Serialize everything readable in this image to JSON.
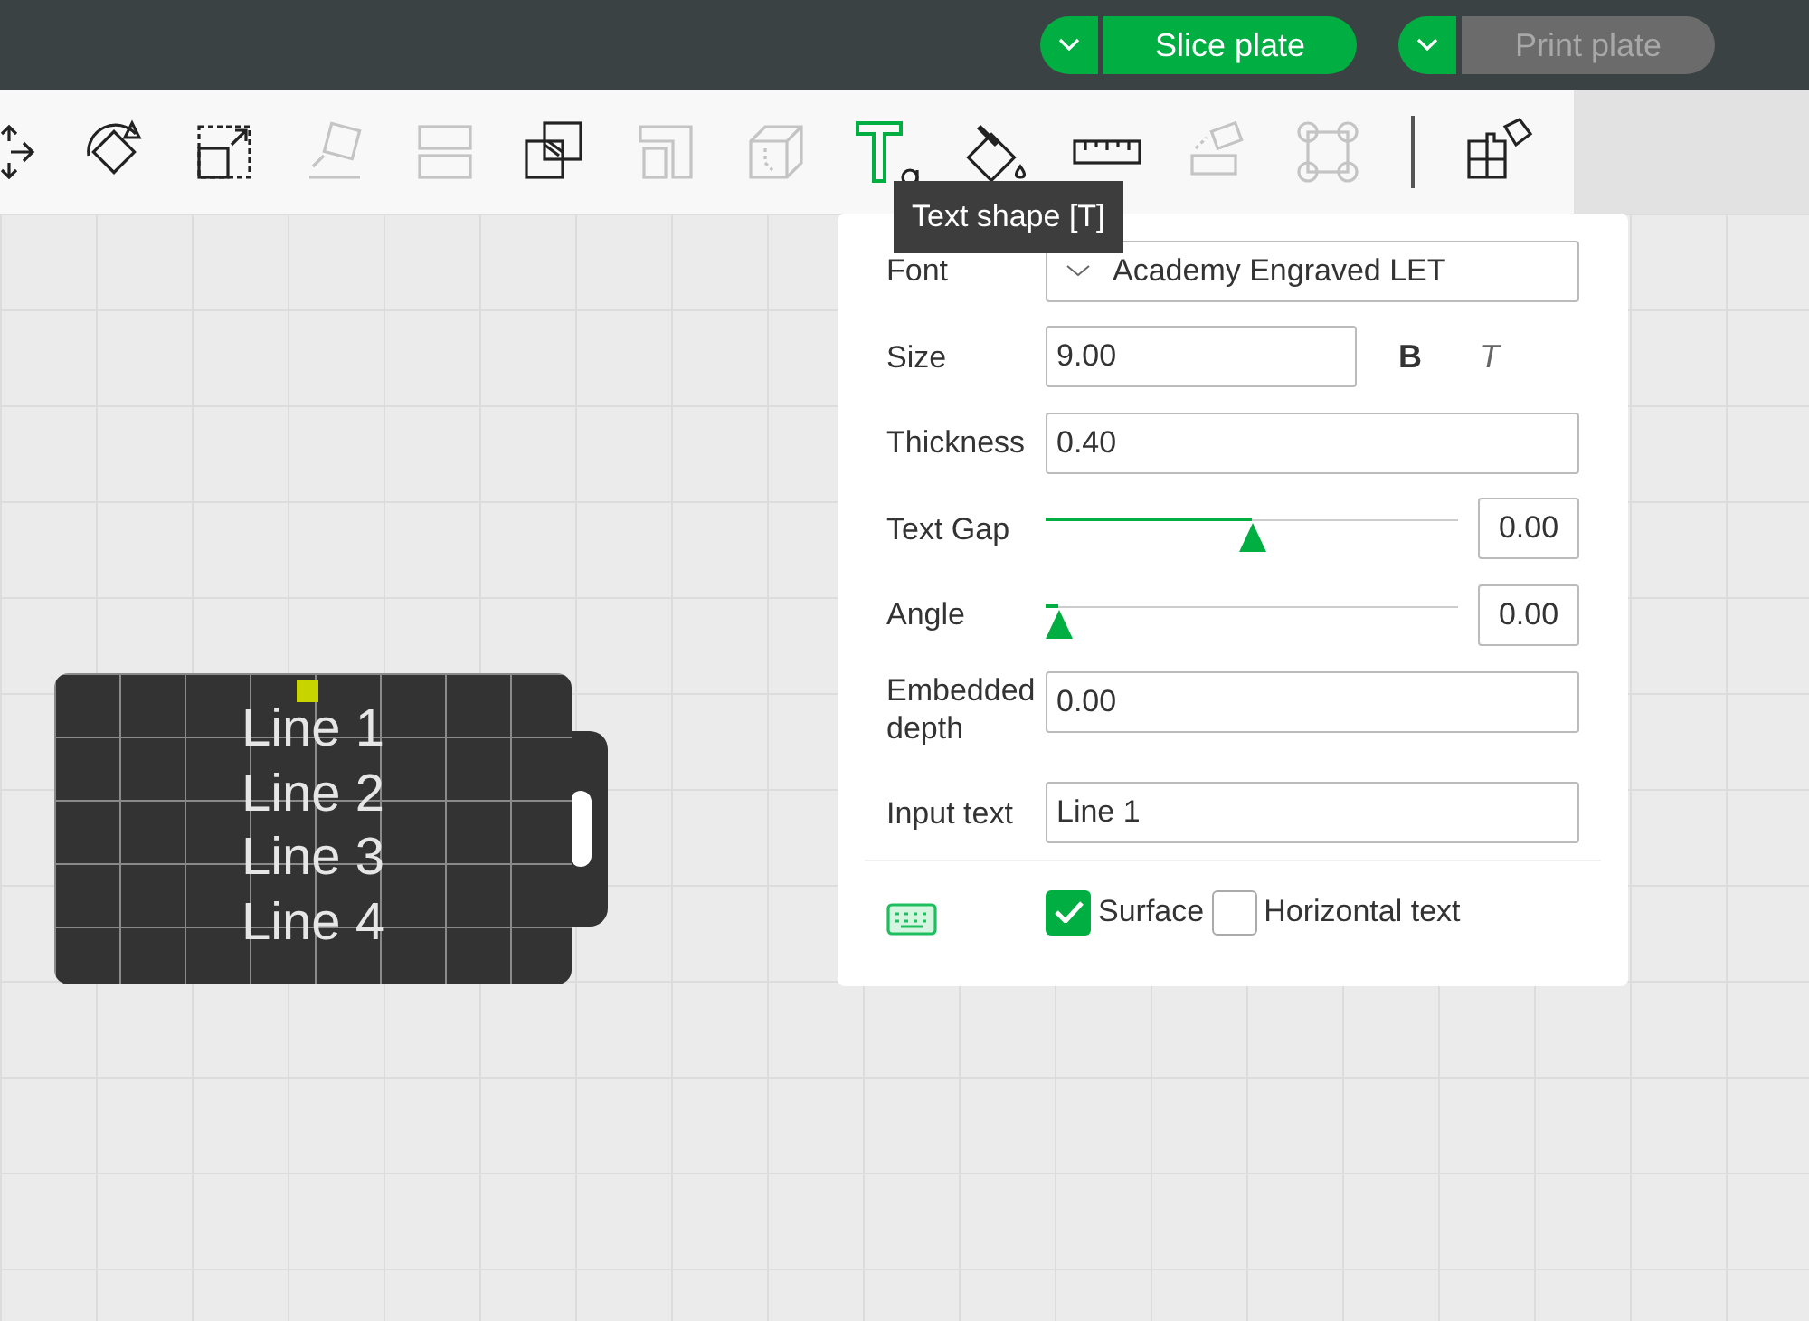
{
  "top_bar": {
    "buttons": [
      {
        "label": "Slice plate",
        "disabled": false
      },
      {
        "label": "Print plate",
        "disabled": true
      }
    ]
  },
  "toolbar": {
    "tools": [
      {
        "kind": "move",
        "disabled": false,
        "selected": false
      },
      {
        "kind": "rotate",
        "disabled": false,
        "selected": false
      },
      {
        "kind": "scale",
        "disabled": false,
        "selected": false
      },
      {
        "kind": "layflat",
        "disabled": true,
        "selected": false
      },
      {
        "kind": "cut",
        "disabled": true,
        "selected": false
      },
      {
        "kind": "boolean",
        "disabled": false,
        "selected": false
      },
      {
        "kind": "support",
        "disabled": true,
        "selected": false
      },
      {
        "kind": "seam",
        "disabled": true,
        "selected": false
      },
      {
        "kind": "text",
        "disabled": false,
        "selected": true
      },
      {
        "kind": "paint",
        "disabled": false,
        "selected": false
      },
      {
        "kind": "measure",
        "disabled": false,
        "selected": false
      },
      {
        "kind": "assembly",
        "disabled": true,
        "selected": false
      },
      {
        "kind": "brim",
        "disabled": true,
        "selected": false
      },
      {
        "kind": "arrange",
        "disabled": false,
        "selected": false
      }
    ],
    "tooltip": "Text shape [T]"
  },
  "model": {
    "lines": [
      "Line 1",
      "Line 2",
      "Line 3",
      "Line 4"
    ]
  },
  "panel": {
    "rows": [
      {
        "kind": "select",
        "label": "Font",
        "value": "Academy Engraved LET"
      },
      {
        "kind": "size",
        "label": "Size",
        "value": "9.00",
        "bold": "B",
        "italic": "T"
      },
      {
        "kind": "field",
        "label": "Thickness",
        "value": "0.40"
      },
      {
        "kind": "slider",
        "label": "Text Gap",
        "level": 0.5,
        "value": "0.00"
      },
      {
        "kind": "slider",
        "label": "Angle",
        "level": 0.03,
        "value": "0.00"
      },
      {
        "kind": "field",
        "label": "Embedded depth",
        "value": "0.00"
      },
      {
        "kind": "field",
        "label": "Input text",
        "value": "Line 1"
      }
    ],
    "options": [
      {
        "label": "Surface",
        "checked": true
      },
      {
        "label": "Horizontal text",
        "checked": false
      }
    ]
  }
}
